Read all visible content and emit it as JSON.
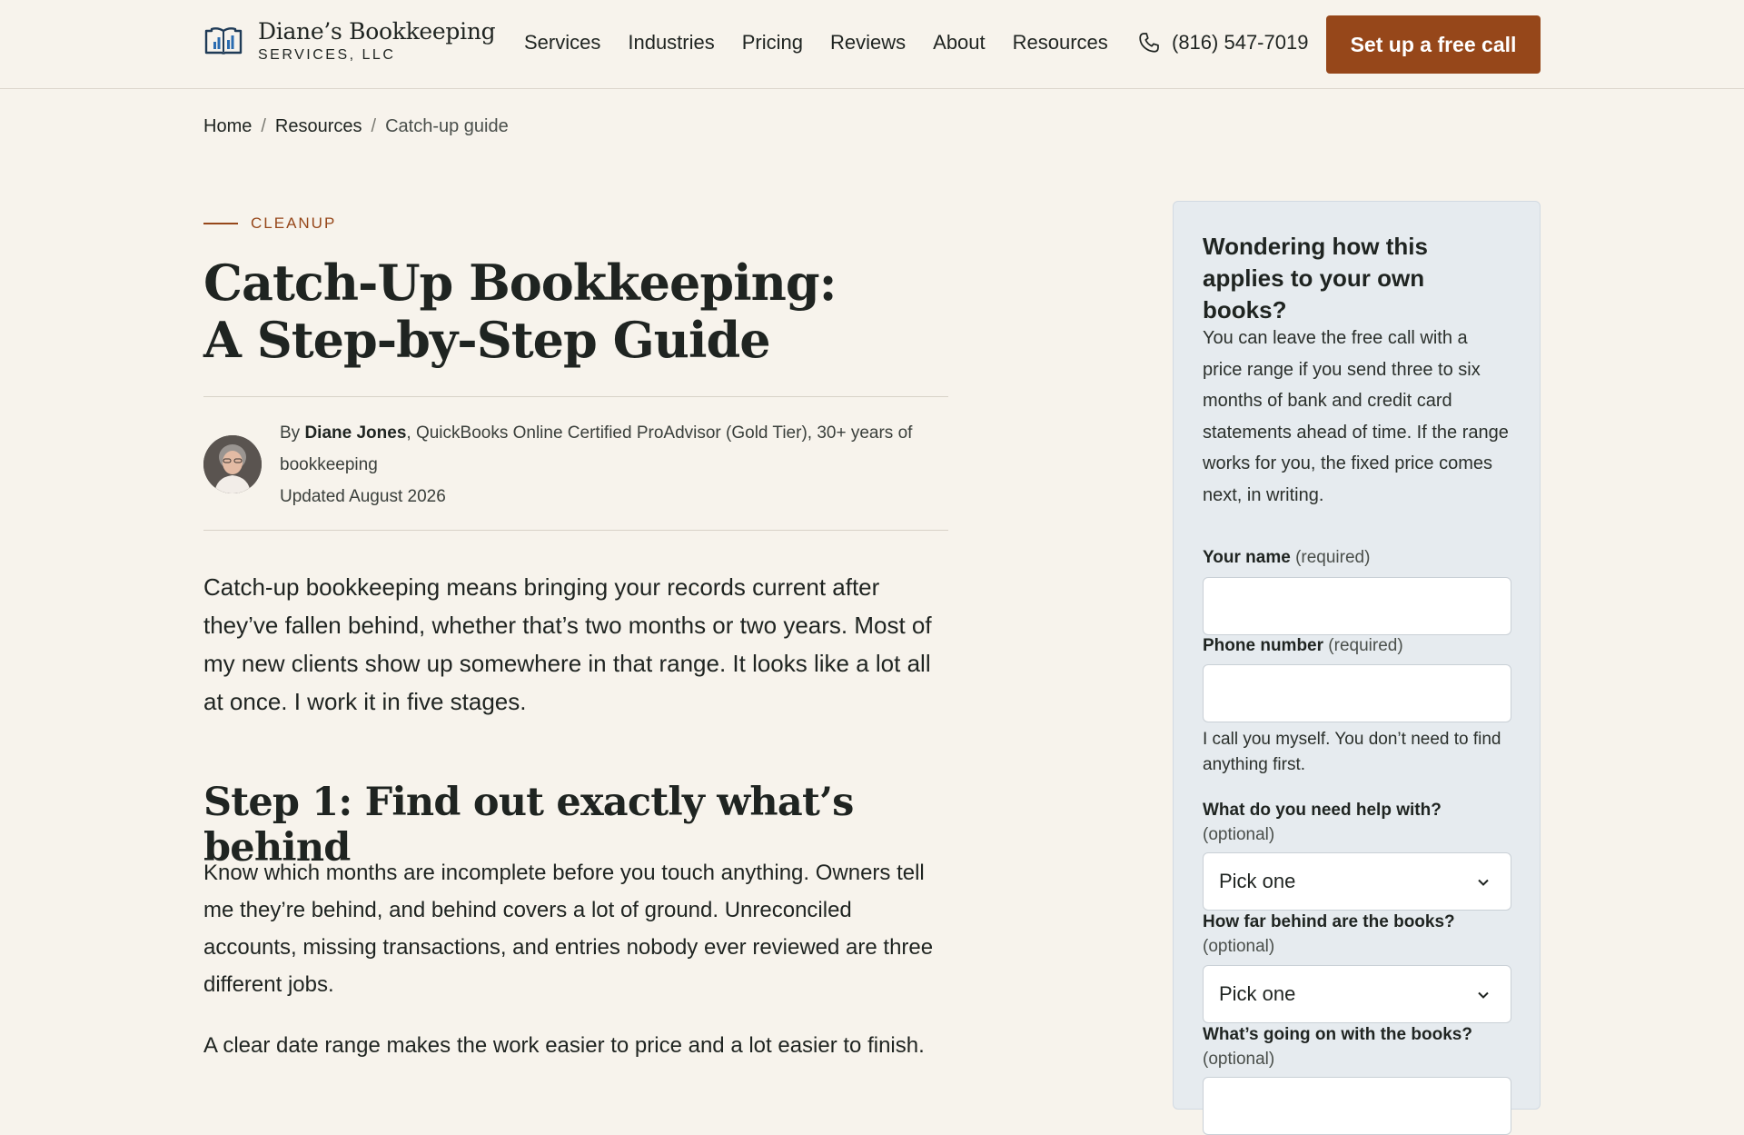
{
  "header": {
    "logo_name": "Diane’s Bookkeeping",
    "logo_sub": "SERVICES, LLC",
    "nav": [
      "Services",
      "Industries",
      "Pricing",
      "Reviews",
      "About",
      "Resources"
    ],
    "phone": "(816) 547-7019",
    "cta": "Set up a free call"
  },
  "breadcrumb": {
    "home": "Home",
    "resources": "Resources",
    "current": "Catch-up guide",
    "separator": "/"
  },
  "article": {
    "eyebrow": "CLEANUP",
    "title_line1": "Catch-Up Bookkeeping:",
    "title_line2": "A Step-by-Step Guide",
    "byline_prefix": "By ",
    "author": "Diane Jones",
    "author_credentials": ", QuickBooks Online Certified ProAdvisor (Gold Tier), 30+ years of bookkeeping",
    "updated": "Updated August 2026",
    "lead": "Catch-up bookkeeping means bringing your records current after they’ve fallen behind, whether that’s two months or two years. Most of my new clients show up somewhere in that range. It looks like a lot all at once. I work it in five stages.",
    "step1_heading": "Step 1: Find out exactly what’s behind",
    "step1_p1": "Know which months are incomplete before you touch anything. Owners tell me they’re behind, and behind covers a lot of ground. Unreconciled accounts, missing transactions, and entries nobody ever reviewed are three different jobs.",
    "step1_p2": "A clear date range makes the work easier to price and a lot easier to finish."
  },
  "sidebar": {
    "title": "Wondering how this applies to your own books?",
    "text": "You can leave the free call with a price range if you send three to six months of bank and credit card statements ahead of time. If the range works for you, the fixed price comes next, in writing.",
    "name_label": "Your name",
    "name_req": "(required)",
    "phone_label": "Phone number",
    "phone_req": "(required)",
    "phone_hint": "I call you myself. You don’t need to find anything first.",
    "help_label": "What do you need help with?",
    "help_opt": "(optional)",
    "help_value": "Pick one",
    "behind_label": "How far behind are the books?",
    "behind_opt": "(optional)",
    "behind_value": "Pick one",
    "going_label": "What’s going on with the books?",
    "going_opt": "(optional)"
  },
  "colors": {
    "accent": "#96471a",
    "background": "#f7f3ec",
    "sidebar_bg": "#e6ebef",
    "logo_blue": "#2b6cb0"
  },
  "icons": [
    "open-book-logo-icon",
    "phone-icon",
    "chevron-down-icon"
  ]
}
